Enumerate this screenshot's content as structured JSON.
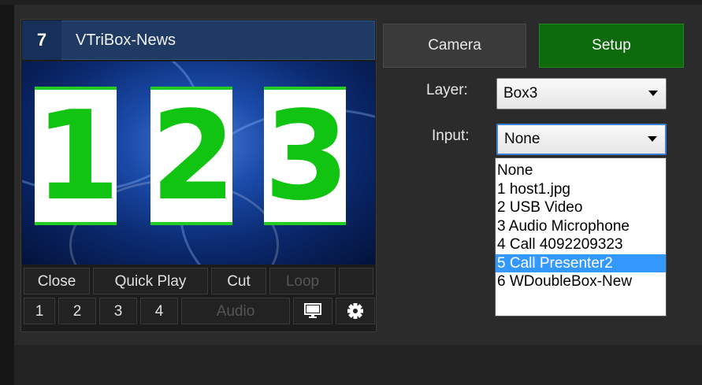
{
  "input": {
    "number": "7",
    "name": "VTriBox-News",
    "preview_digits": [
      "1",
      "2",
      "3"
    ],
    "controls_row1": [
      {
        "label": "Close",
        "enabled": true
      },
      {
        "label": "Quick Play",
        "enabled": true
      },
      {
        "label": "Cut",
        "enabled": true
      },
      {
        "label": "Loop",
        "enabled": false
      }
    ],
    "controls_row2": [
      {
        "label": "1",
        "enabled": true
      },
      {
        "label": "2",
        "enabled": true
      },
      {
        "label": "3",
        "enabled": true
      },
      {
        "label": "4",
        "enabled": true
      },
      {
        "label": "Audio",
        "enabled": false
      }
    ],
    "icons": [
      "monitor-icon",
      "gear-icon"
    ]
  },
  "tabs": {
    "camera": "Camera",
    "setup": "Setup",
    "active": "Setup",
    "active_color": "#0c6a0c"
  },
  "setup": {
    "layer_label": "Layer:",
    "layer_value": "Box3",
    "input_label": "Input:",
    "input_value": "None",
    "input_options": [
      "None",
      "1 host1.jpg",
      "2 USB Video",
      "3 Audio Microphone",
      "4 Call 4092209323",
      "5 Call Presenter2",
      "6 WDoubleBox-New"
    ],
    "highlighted_option": "5 Call Presenter2",
    "highlight_color": "#3399ff"
  }
}
